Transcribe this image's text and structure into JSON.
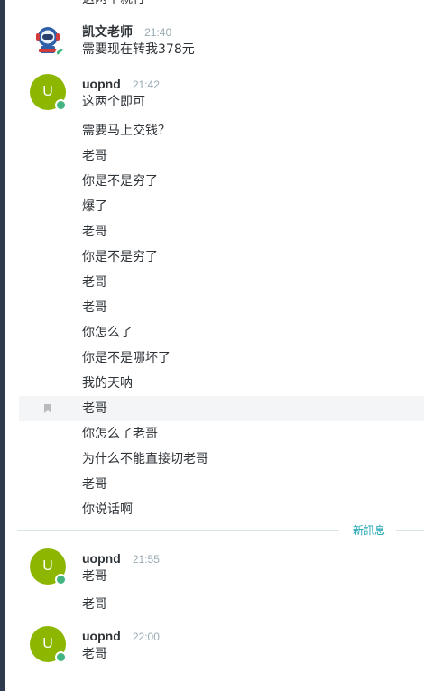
{
  "top_partial_text": "这两个就行",
  "colors": {
    "user_avatar": "#8db600",
    "online_status": "#43b581",
    "new_divider": "#1aa3b1"
  },
  "groups": [
    {
      "avatar_type": "robot-avatar",
      "username": "凯文老师",
      "time": "21:40",
      "lines": [
        "需要现在转我378元"
      ]
    },
    {
      "avatar_letter": "U",
      "username": "uopnd",
      "time": "21:42",
      "lines": [
        "这两个即可",
        "需要马上交钱？",
        "老哥",
        "你是不是穷了",
        "爆了",
        "老哥",
        "你是不是穷了",
        "老哥",
        "老哥",
        "你怎么了",
        "你是不是哪坏了",
        "我的天呐",
        "老哥",
        "你怎么了老哥",
        "为什么不能直接切老哥",
        "老哥",
        "你说话啊"
      ]
    },
    {
      "avatar_letter": "U",
      "username": "uopnd",
      "time": "21:55",
      "lines": [
        "老哥",
        "老哥"
      ]
    },
    {
      "avatar_letter": "U",
      "username": "uopnd",
      "time": "22:00",
      "lines": [
        "老哥"
      ]
    }
  ],
  "new_messages_divider": "新訊息",
  "bookmark_icon": "bookmark-icon"
}
